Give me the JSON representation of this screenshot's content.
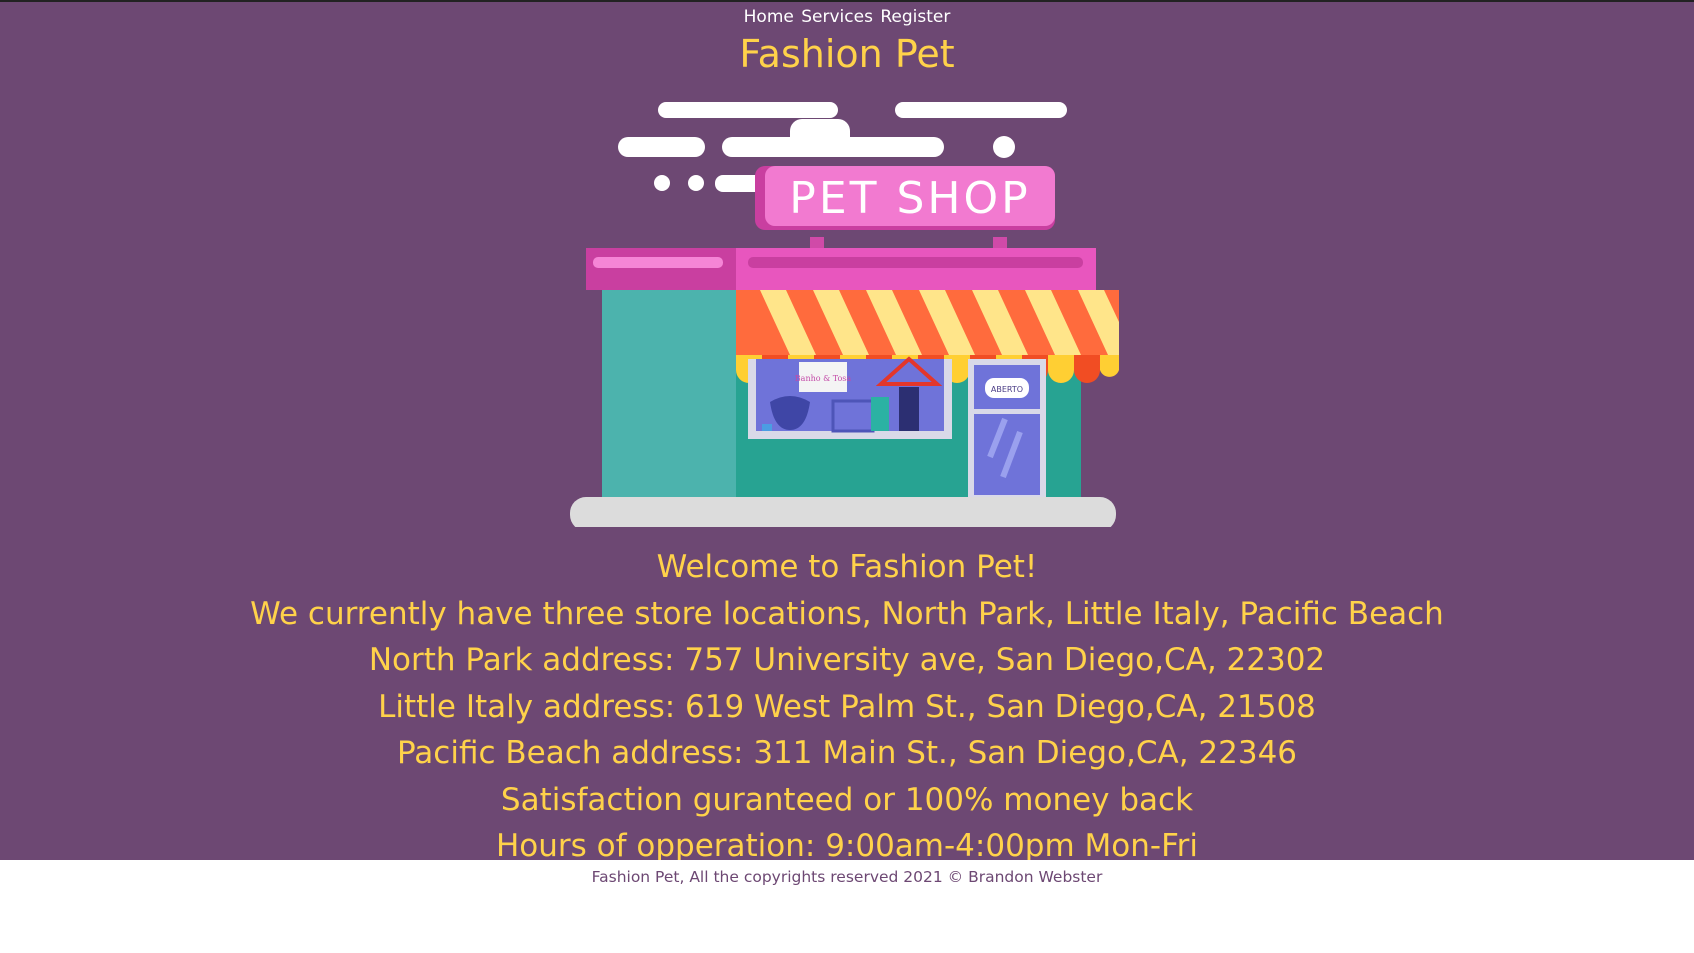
{
  "nav": {
    "items": [
      "Home",
      "Services",
      "Register"
    ]
  },
  "header": {
    "title": "Fashion Pet"
  },
  "hero": {
    "sign_text": "PET SHOP",
    "window_sign": "Banho & Tosa",
    "door_sign": "ABERTO"
  },
  "content": {
    "lines": [
      "Welcome to Fashion Pet!",
      "We currently have three store locations, North Park, Little Italy, Pacific Beach",
      "North Park address: 757 University ave, San Diego,CA, 22302",
      "Little Italy address: 619 West Palm St., San Diego,CA, 21508",
      "Pacific Beach address: 311 Main St., San Diego,CA, 22346",
      "Satisfaction guranteed or 100% money back",
      "Hours of opperation: 9:00am-4:00pm Mon-Fri"
    ]
  },
  "footer": {
    "text": "Fashion Pet, All the copyrights reserved 2021 © Brandon Webster"
  },
  "colors": {
    "background": "#6d4873",
    "accent": "#ffd24a",
    "nav_text": "#ffffff",
    "footer_bg": "#ffffff",
    "footer_text": "#6d4873"
  }
}
